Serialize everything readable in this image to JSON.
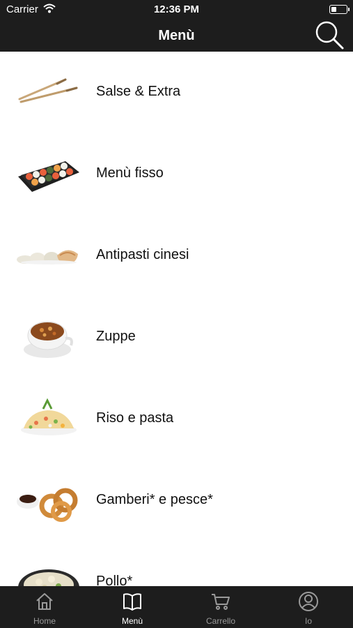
{
  "status_bar": {
    "carrier": "Carrier",
    "time": "12:36 PM"
  },
  "header": {
    "title": "Menù",
    "search_icon": "search-icon"
  },
  "categories": [
    {
      "label": "Salse & Extra",
      "image": "chopsticks"
    },
    {
      "label": "Menù fisso",
      "image": "sushi-tray"
    },
    {
      "label": "Antipasti cinesi",
      "image": "dumplings"
    },
    {
      "label": "Zuppe",
      "image": "soup-bowl"
    },
    {
      "label": "Riso e pasta",
      "image": "fried-rice"
    },
    {
      "label": "Gamberi* e pesce*",
      "image": "fried-shrimp"
    },
    {
      "label": "Pollo*",
      "image": "chicken-dish"
    }
  ],
  "tab_bar": {
    "tabs": [
      {
        "label": "Home",
        "icon": "home-icon",
        "active": false
      },
      {
        "label": "Menù",
        "icon": "book-icon",
        "active": true
      },
      {
        "label": "Carrello",
        "icon": "cart-icon",
        "active": false
      },
      {
        "label": "Io",
        "icon": "user-icon",
        "active": false
      }
    ]
  },
  "colors": {
    "bar_background": "#1d1d1d",
    "tab_inactive": "#9a9a9a",
    "tab_active": "#ffffff"
  }
}
